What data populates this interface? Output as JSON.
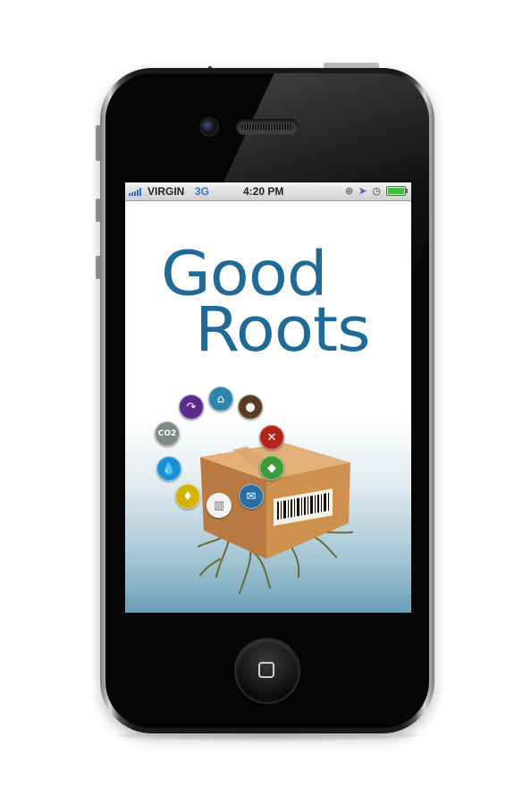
{
  "status_bar": {
    "carrier": "VIRGIN",
    "network": "3G",
    "time": "4:20 PM",
    "battery_level": 1.0
  },
  "app": {
    "title_line1": "Good",
    "title_line2": "Roots"
  },
  "feature_icons": [
    {
      "name": "refresh-icon",
      "color": "#5b2c8c"
    },
    {
      "name": "home-icon",
      "color": "#2e86ab"
    },
    {
      "name": "person-icon",
      "color": "#5a3b22"
    },
    {
      "name": "co2-icon",
      "color": "#7f8a86",
      "label": "CO2"
    },
    {
      "name": "tools-icon",
      "color": "#b3261e"
    },
    {
      "name": "water-drop-icon",
      "color": "#1b8fd1"
    },
    {
      "name": "tag-icon",
      "color": "#3f9b3a"
    },
    {
      "name": "lightbulb-icon",
      "color": "#d6b200"
    },
    {
      "name": "factory-icon",
      "color": "#f2f2f2"
    },
    {
      "name": "mail-icon",
      "color": "#2a6fa3"
    }
  ],
  "colors": {
    "title": "#1f6a96",
    "box": "#c98a4f"
  }
}
